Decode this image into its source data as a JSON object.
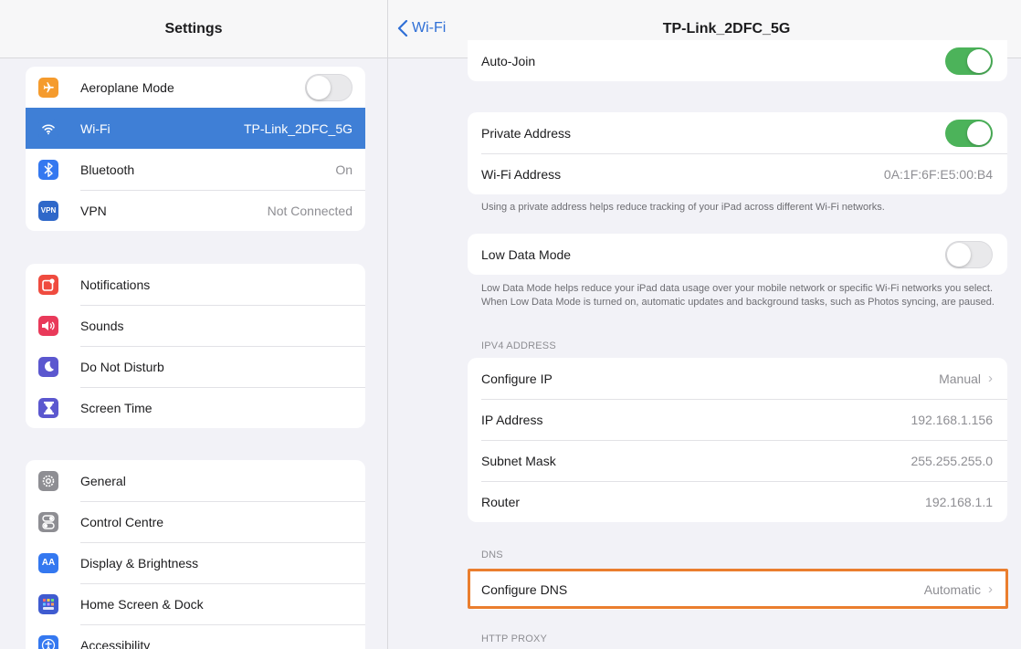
{
  "left": {
    "title": "Settings",
    "group1": [
      {
        "label": "Aeroplane Mode",
        "icon": "airplane-icon",
        "color": "#f59b2d",
        "toggle": "off"
      },
      {
        "label": "Wi-Fi",
        "icon": "wifi-icon",
        "color": "#3f7fd6",
        "value": "TP-Link_2DFC_5G",
        "selected": true
      },
      {
        "label": "Bluetooth",
        "icon": "bluetooth-icon",
        "color": "#3478f0",
        "value": "On"
      },
      {
        "label": "VPN",
        "icon": "vpn-icon",
        "color": "#2f68c9",
        "icon_text": "VPN",
        "value": "Not Connected"
      }
    ],
    "group2": [
      {
        "label": "Notifications",
        "icon": "notifications-icon",
        "color": "#ef4b3f"
      },
      {
        "label": "Sounds",
        "icon": "sounds-icon",
        "color": "#e93a5a"
      },
      {
        "label": "Do Not Disturb",
        "icon": "moon-icon",
        "color": "#5b57cf"
      },
      {
        "label": "Screen Time",
        "icon": "hourglass-icon",
        "color": "#5b57cf"
      }
    ],
    "group3": [
      {
        "label": "General",
        "icon": "gear-icon",
        "color": "#8e8e93"
      },
      {
        "label": "Control Centre",
        "icon": "control-centre-icon",
        "color": "#8e8e93"
      },
      {
        "label": "Display & Brightness",
        "icon": "display-icon",
        "color": "#3478f0",
        "icon_text": "AA"
      },
      {
        "label": "Home Screen & Dock",
        "icon": "home-screen-icon",
        "color": "#3f5bd0"
      },
      {
        "label": "Accessibility",
        "icon": "accessibility-icon",
        "color": "#3478f0"
      }
    ]
  },
  "right": {
    "back_label": "Wi-Fi",
    "title": "TP-Link_2DFC_5G",
    "auto_join": {
      "label": "Auto-Join",
      "toggle": "on"
    },
    "private_address": {
      "label": "Private Address",
      "toggle": "on"
    },
    "wifi_address": {
      "label": "Wi-Fi Address",
      "value": "0A:1F:6F:E5:00:B4"
    },
    "private_note": "Using a private address helps reduce tracking of your iPad across different Wi-Fi networks.",
    "low_data": {
      "label": "Low Data Mode",
      "toggle": "off"
    },
    "low_data_note": "Low Data Mode helps reduce your iPad data usage over your mobile network or specific Wi-Fi networks you select. When Low Data Mode is turned on, automatic updates and background tasks, such as Photos syncing, are paused.",
    "ipv4_header": "IPV4 ADDRESS",
    "ipv4_rows": [
      {
        "label": "Configure IP",
        "value": "Manual",
        "chevron": true
      },
      {
        "label": "IP Address",
        "value": "192.168.1.156"
      },
      {
        "label": "Subnet Mask",
        "value": "255.255.255.0"
      },
      {
        "label": "Router",
        "value": "192.168.1.1"
      }
    ],
    "dns_header": "DNS",
    "configure_dns": {
      "label": "Configure DNS",
      "value": "Automatic"
    },
    "http_proxy_header": "HTTP PROXY",
    "highlight_color": "#ea7e2e"
  }
}
